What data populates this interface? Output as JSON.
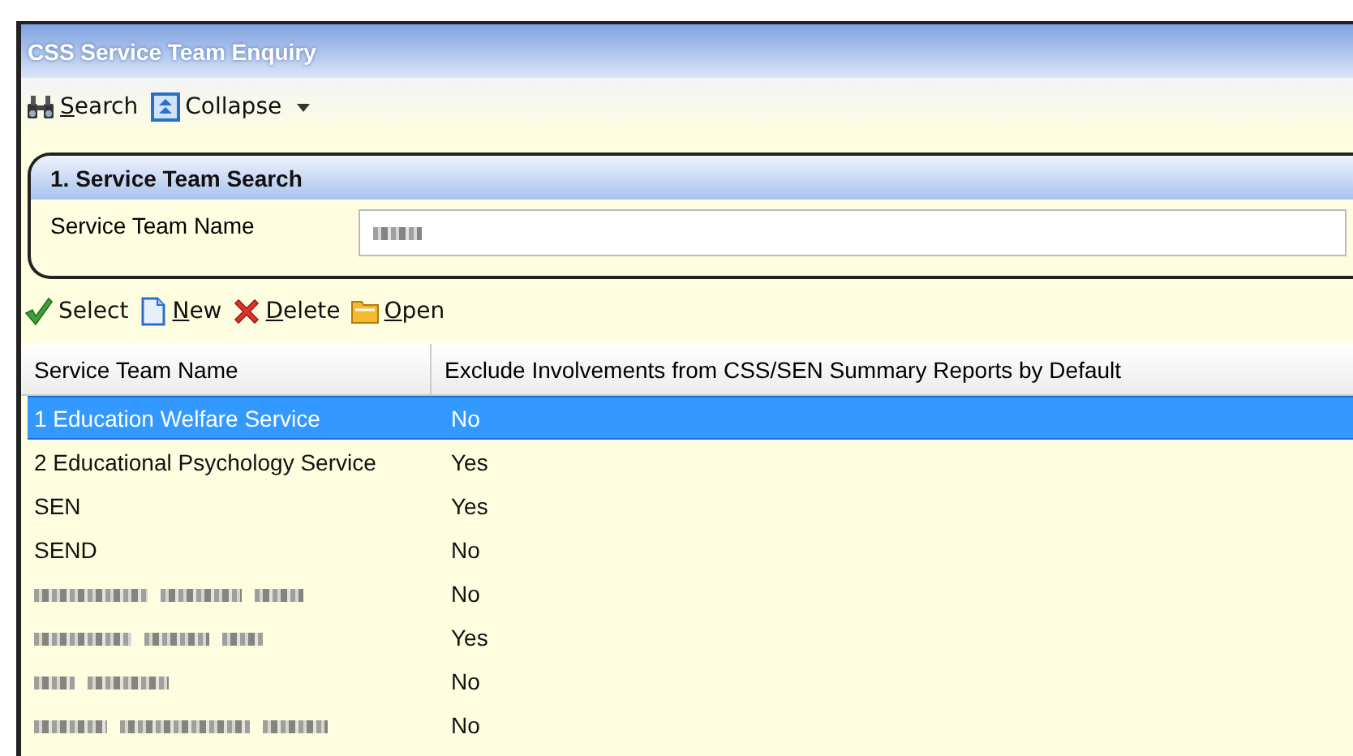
{
  "window": {
    "title": "CSS Service Team Enquiry"
  },
  "toolbar": [
    {
      "kind": "search",
      "label": "Search",
      "mnemonic": true
    },
    {
      "kind": "collapse",
      "label": "Collapse",
      "mnemonic": false,
      "dropdown": true
    }
  ],
  "search_section": {
    "title": "1. Service Team Search",
    "field": {
      "label": "Service Team Name",
      "redacted": true
    }
  },
  "actions": [
    {
      "kind": "select",
      "label": "Select",
      "mnemonic": false
    },
    {
      "kind": "new",
      "label": "New",
      "mnemonic": true
    },
    {
      "kind": "delete",
      "label": "Delete",
      "mnemonic": true
    },
    {
      "kind": "open",
      "label": "Open",
      "mnemonic": true
    }
  ],
  "table": {
    "columns": [
      "Service Team Name",
      "Exclude Involvements from CSS/SEN Summary Reports by Default"
    ],
    "rows": [
      {
        "name": "1 Education Welfare Service",
        "exclude": "No",
        "selected": true
      },
      {
        "name": "2 Educational Psychology Service",
        "exclude": "Yes",
        "selected": false
      },
      {
        "name": "SEN",
        "exclude": "Yes",
        "selected": false
      },
      {
        "name": "SEND",
        "exclude": "No",
        "selected": false
      },
      {
        "kind": "redacted",
        "exclude": "No",
        "selected": false
      },
      {
        "kind": "redacted",
        "exclude": "Yes",
        "selected": false
      },
      {
        "kind": "redacted",
        "exclude": "No",
        "selected": false
      },
      {
        "kind": "redacted",
        "exclude": "No",
        "selected": false
      }
    ]
  }
}
